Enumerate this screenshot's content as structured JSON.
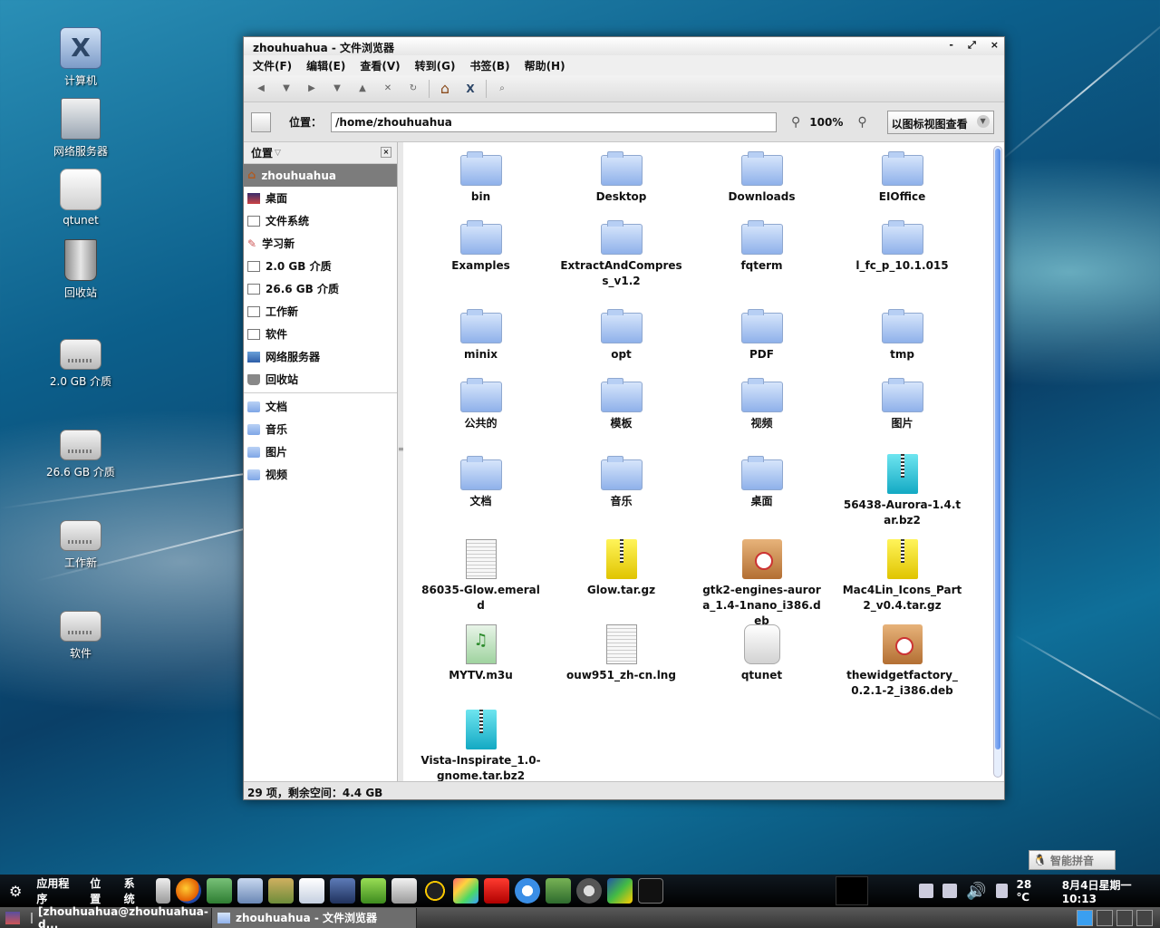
{
  "desktop": {
    "icons": [
      {
        "label": "计算机",
        "icon": "computer-icon"
      },
      {
        "label": "网络服务器",
        "icon": "network-server-icon"
      },
      {
        "label": "qtunet",
        "icon": "qtunet-icon"
      },
      {
        "label": "回收站",
        "icon": "trash-icon"
      },
      {
        "label": "2.0 GB 介质",
        "icon": "drive-icon"
      },
      {
        "label": "26.6 GB 介质",
        "icon": "drive-icon"
      },
      {
        "label": "工作新",
        "icon": "drive-icon"
      },
      {
        "label": "软件",
        "icon": "drive-icon"
      }
    ]
  },
  "window": {
    "title": "zhouhuahua - 文件浏览器",
    "controls": {
      "minimize": "-",
      "maximize": "⤢",
      "close": "×"
    },
    "menus": [
      "文件(F)",
      "编辑(E)",
      "查看(V)",
      "转到(G)",
      "书签(B)",
      "帮助(H)"
    ],
    "location": {
      "label": "位置：",
      "value": "/home/zhouhuahua",
      "zoom": "100%",
      "view_mode": "以图标视图查看"
    },
    "sidebar": {
      "header": "位置",
      "places": [
        {
          "label": "zhouhuahua",
          "icon": "home-icon"
        },
        {
          "label": "桌面",
          "icon": "desktop-icon"
        },
        {
          "label": "文件系统",
          "icon": "filesystem-icon"
        },
        {
          "label": "学习新",
          "icon": "study-icon"
        },
        {
          "label": "2.0 GB 介质",
          "icon": "drive-icon"
        },
        {
          "label": "26.6 GB 介质",
          "icon": "drive-icon"
        },
        {
          "label": "工作新",
          "icon": "drive-icon"
        },
        {
          "label": "软件",
          "icon": "drive-icon"
        },
        {
          "label": "网络服务器",
          "icon": "network-icon"
        },
        {
          "label": "回收站",
          "icon": "trash-icon"
        }
      ],
      "bookmarks": [
        {
          "label": "文档",
          "icon": "folder-icon"
        },
        {
          "label": "音乐",
          "icon": "folder-icon"
        },
        {
          "label": "图片",
          "icon": "folder-icon"
        },
        {
          "label": "视频",
          "icon": "folder-icon"
        }
      ]
    },
    "files": [
      {
        "name": "bin",
        "type": "folder"
      },
      {
        "name": "Desktop",
        "type": "folder"
      },
      {
        "name": "Downloads",
        "type": "folder"
      },
      {
        "name": "EIOffice",
        "type": "folder"
      },
      {
        "name": "Examples",
        "type": "folder"
      },
      {
        "name": "ExtractAndCompress_v1.2",
        "type": "folder"
      },
      {
        "name": "fqterm",
        "type": "folder"
      },
      {
        "name": "l_fc_p_10.1.015",
        "type": "folder"
      },
      {
        "name": "minix",
        "type": "folder"
      },
      {
        "name": "opt",
        "type": "folder"
      },
      {
        "name": "PDF",
        "type": "folder"
      },
      {
        "name": "tmp",
        "type": "folder"
      },
      {
        "name": "公共的",
        "type": "folder"
      },
      {
        "name": "模板",
        "type": "folder"
      },
      {
        "name": "视频",
        "type": "folder"
      },
      {
        "name": "图片",
        "type": "folder"
      },
      {
        "name": "文档",
        "type": "folder"
      },
      {
        "name": "音乐",
        "type": "folder"
      },
      {
        "name": "桌面",
        "type": "folder"
      },
      {
        "name": "56438-Aurora-1.4.tar.bz2",
        "type": "bz2"
      },
      {
        "name": "86035-Glow.emerald",
        "type": "doc"
      },
      {
        "name": "Glow.tar.gz",
        "type": "gz"
      },
      {
        "name": "gtk2-engines-aurora_1.4-1nano_i386.deb",
        "type": "deb"
      },
      {
        "name": "Mac4Lin_Icons_Part2_v0.4.tar.gz",
        "type": "gz"
      },
      {
        "name": "MYTV.m3u",
        "type": "playlist"
      },
      {
        "name": "ouw951_zh-cn.lng",
        "type": "doc"
      },
      {
        "name": "qtunet",
        "type": "qtunet"
      },
      {
        "name": "thewidgetfactory_0.2.1-2_i386.deb",
        "type": "deb"
      },
      {
        "name": "Vista-Inspirate_1.0-gnome.tar.bz2",
        "type": "bz2"
      }
    ],
    "status": "29 项，剩余空间：4.4 GB"
  },
  "panel": {
    "menus": [
      "应用程序",
      "位置",
      "系统"
    ],
    "temperature": "28 ℃",
    "datetime": "8月4日星期一 10:13",
    "ime": "智能拼音",
    "tasks": [
      {
        "label": "[zhouhuahua@zhouhuahua-d...",
        "icon": "terminal-icon"
      },
      {
        "label": "zhouhuahua - 文件浏览器",
        "icon": "folder-icon"
      }
    ]
  }
}
